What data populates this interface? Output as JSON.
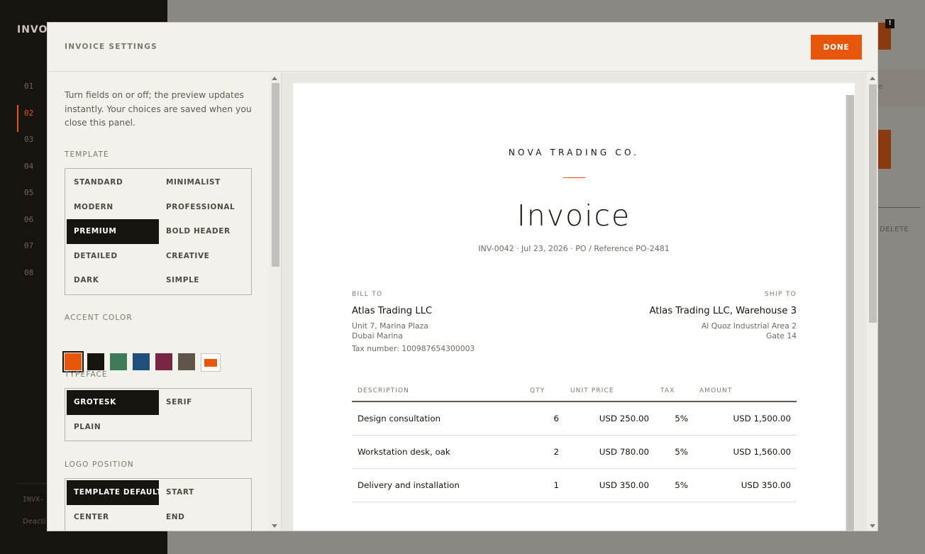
{
  "app": {
    "brand": "INVOI",
    "steps": [
      "01",
      "02",
      "03",
      "04",
      "05",
      "06",
      "07",
      "08"
    ],
    "active_step": "02",
    "footer_id": "INVX-",
    "footer_text": "Deacti",
    "banner_text": "e",
    "delete_label": "DELETE",
    "alert_glyph": "!"
  },
  "modal": {
    "title": "INVOICE SETTINGS",
    "done_label": "DONE"
  },
  "settings": {
    "intro": "Turn fields on or off; the preview updates instantly. Your choices are saved when you close this panel.",
    "template": {
      "label": "TEMPLATE",
      "options": [
        "STANDARD",
        "MINIMALIST",
        "MODERN",
        "PROFESSIONAL",
        "PREMIUM",
        "BOLD HEADER",
        "DETAILED",
        "CREATIVE",
        "DARK",
        "SIMPLE"
      ],
      "selected": "PREMIUM"
    },
    "accent": {
      "label": "ACCENT COLOR",
      "colors": [
        "#e8560c",
        "#17140f",
        "#3d7a57",
        "#1f4f7a",
        "#7a2543",
        "#5e564a"
      ],
      "custom_color": "#e8560c",
      "selected": "#e8560c"
    },
    "typeface": {
      "label": "TYPEFACE",
      "options": [
        "GROTESK",
        "SERIF",
        "PLAIN"
      ],
      "selected": "GROTESK"
    },
    "logo_position": {
      "label": "LOGO POSITION",
      "options": [
        "TEMPLATE DEFAULT",
        "START",
        "CENTER",
        "END"
      ],
      "selected": "TEMPLATE DEFAULT"
    }
  },
  "invoice": {
    "company": "NOVA TRADING CO.",
    "title": "Invoice",
    "meta": "INV-0042 · Jul 23, 2026 · PO / Reference PO-2481",
    "bill_to": {
      "label": "BILL TO",
      "name": "Atlas Trading LLC",
      "lines": [
        "Unit 7, Marina Plaza",
        "Dubai Marina",
        "Tax number: 100987654300003"
      ]
    },
    "ship_to": {
      "label": "SHIP TO",
      "name": "Atlas Trading LLC, Warehouse 3",
      "lines": [
        "Al Quoz Industrial Area 2",
        "Gate 14"
      ]
    },
    "columns": [
      "DESCRIPTION",
      "QTY",
      "UNIT PRICE",
      "TAX",
      "AMOUNT"
    ],
    "items": [
      {
        "description": "Design consultation",
        "qty": "6",
        "unit_price": "USD 250.00",
        "tax": "5%",
        "amount": "USD 1,500.00"
      },
      {
        "description": "Workstation desk, oak",
        "qty": "2",
        "unit_price": "USD 780.00",
        "tax": "5%",
        "amount": "USD 1,560.00"
      },
      {
        "description": "Delivery and installation",
        "qty": "1",
        "unit_price": "USD 350.00",
        "tax": "5%",
        "amount": "USD 350.00"
      }
    ]
  }
}
